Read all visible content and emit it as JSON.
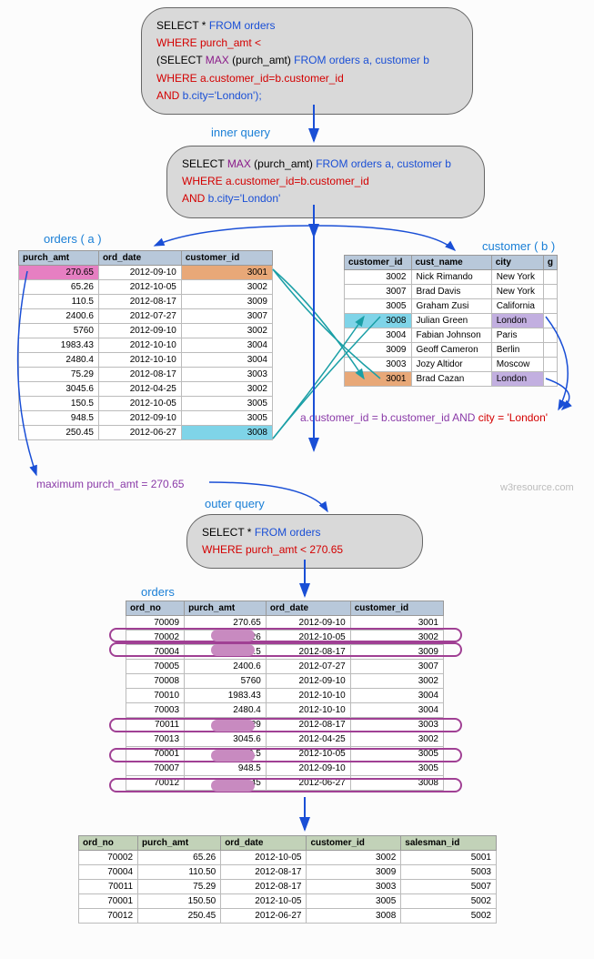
{
  "sql1": {
    "line1a": "SELECT * ",
    "line1b": "FROM orders",
    "line2": "WHERE purch_amt <",
    "line3a": "(SELECT ",
    "line3b": "MAX",
    "line3c": " (purch_amt) ",
    "line3d": "FROM orders a, customer b",
    "line4": "WHERE  a.customer_id=b.customer_id",
    "line5a": "AND",
    "line5b": " b.city='London');"
  },
  "sql2": {
    "line1a": "SELECT ",
    "line1b": "MAX",
    "line1c": " (purch_amt) ",
    "line1d": "FROM orders a, customer b",
    "line2": "WHERE  a.customer_id=b.customer_id",
    "line3a": "AND",
    "line3b": " b.city='London'"
  },
  "sql3": {
    "line1a": "SELECT * ",
    "line1b": "FROM orders",
    "line2": "WHERE purch_amt < 270.65"
  },
  "labels": {
    "inner": "inner query",
    "orders_a": "orders ( a )",
    "customer_b": "customer ( b )",
    "join": "a.customer_id = b.customer_id AND ",
    "city": "city = 'London'",
    "max": "maximum purch_amt = 270.65",
    "outer": "outer query",
    "orders": "orders",
    "watermark": "w3resource.com"
  },
  "orders_a": {
    "headers": [
      "purch_amt",
      "ord_date",
      "customer_id"
    ],
    "rows": [
      [
        "270.65",
        "2012-09-10",
        "3001"
      ],
      [
        "65.26",
        "2012-10-05",
        "3002"
      ],
      [
        "110.5",
        "2012-08-17",
        "3009"
      ],
      [
        "2400.6",
        "2012-07-27",
        "3007"
      ],
      [
        "5760",
        "2012-09-10",
        "3002"
      ],
      [
        "1983.43",
        "2012-10-10",
        "3004"
      ],
      [
        "2480.4",
        "2012-10-10",
        "3004"
      ],
      [
        "75.29",
        "2012-08-17",
        "3003"
      ],
      [
        "3045.6",
        "2012-04-25",
        "3002"
      ],
      [
        "150.5",
        "2012-10-05",
        "3005"
      ],
      [
        "948.5",
        "2012-09-10",
        "3005"
      ],
      [
        "250.45",
        "2012-06-27",
        "3008"
      ]
    ]
  },
  "customer": {
    "headers": [
      "customer_id",
      "cust_name",
      "city",
      "g"
    ],
    "rows": [
      [
        "3002",
        "Nick Rimando",
        "New York"
      ],
      [
        "3007",
        "Brad Davis",
        "New York"
      ],
      [
        "3005",
        "Graham Zusi",
        "California"
      ],
      [
        "3008",
        "Julian Green",
        "London"
      ],
      [
        "3004",
        "Fabian Johnson",
        "Paris"
      ],
      [
        "3009",
        "Geoff Cameron",
        "Berlin"
      ],
      [
        "3003",
        "Jozy Altidor",
        "Moscow"
      ],
      [
        "3001",
        "Brad Cazan",
        "London"
      ]
    ]
  },
  "orders_full": {
    "headers": [
      "ord_no",
      "purch_amt",
      "ord_date",
      "customer_id"
    ],
    "rows": [
      [
        "70009",
        "270.65",
        "2012-09-10",
        "3001"
      ],
      [
        "70002",
        "65.26",
        "2012-10-05",
        "3002"
      ],
      [
        "70004",
        "110.5",
        "2012-08-17",
        "3009"
      ],
      [
        "70005",
        "2400.6",
        "2012-07-27",
        "3007"
      ],
      [
        "70008",
        "5760",
        "2012-09-10",
        "3002"
      ],
      [
        "70010",
        "1983.43",
        "2012-10-10",
        "3004"
      ],
      [
        "70003",
        "2480.4",
        "2012-10-10",
        "3004"
      ],
      [
        "70011",
        "75.29",
        "2012-08-17",
        "3003"
      ],
      [
        "70013",
        "3045.6",
        "2012-04-25",
        "3002"
      ],
      [
        "70001",
        "150.5",
        "2012-10-05",
        "3005"
      ],
      [
        "70007",
        "948.5",
        "2012-09-10",
        "3005"
      ],
      [
        "70012",
        "250.45",
        "2012-06-27",
        "3008"
      ]
    ]
  },
  "result": {
    "headers": [
      "ord_no",
      "purch_amt",
      "ord_date",
      "customer_id",
      "salesman_id"
    ],
    "rows": [
      [
        "70002",
        "65.26",
        "2012-10-05",
        "3002",
        "5001"
      ],
      [
        "70004",
        "110.50",
        "2012-08-17",
        "3009",
        "5003"
      ],
      [
        "70011",
        "75.29",
        "2012-08-17",
        "3003",
        "5007"
      ],
      [
        "70001",
        "150.50",
        "2012-10-05",
        "3005",
        "5002"
      ],
      [
        "70012",
        "250.45",
        "2012-06-27",
        "3008",
        "5002"
      ]
    ]
  },
  "chart_data": {
    "type": "table",
    "description": "SQL subquery explanation diagram",
    "outer_query": "SELECT * FROM orders WHERE purch_amt < (subquery)",
    "inner_query": "SELECT MAX(purch_amt) FROM orders a, customer b WHERE a.customer_id=b.customer_id AND b.city='London'",
    "inner_result": 270.65,
    "join_condition": "a.customer_id = b.customer_id AND city = 'London'",
    "matched_customers": [
      3001,
      3008
    ],
    "final_rows": 5
  }
}
